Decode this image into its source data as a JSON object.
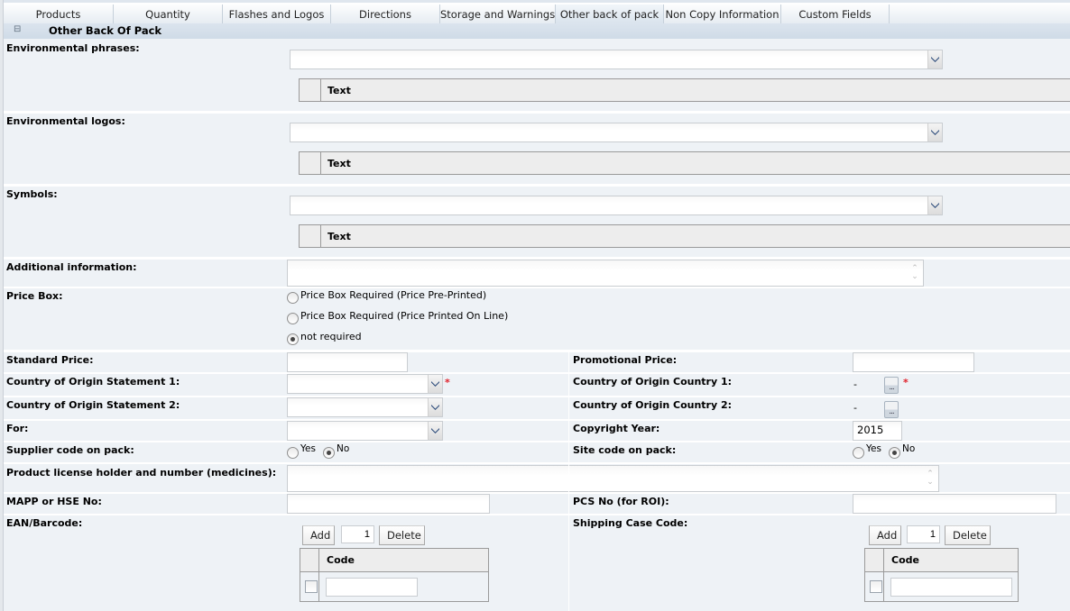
{
  "tabs": [
    {
      "label": "Products",
      "active": false
    },
    {
      "label": "Quantity",
      "active": false
    },
    {
      "label": "Flashes and Logos",
      "active": false
    },
    {
      "label": "Directions",
      "active": false
    },
    {
      "label": "Storage and Warnings",
      "active": false
    },
    {
      "label": "Other back of pack",
      "active": true
    },
    {
      "label": "Non Copy Information",
      "active": false
    },
    {
      "label": "Custom Fields",
      "active": false
    }
  ],
  "section": {
    "collapse_icon": "⊟",
    "title": "Other Back Of Pack"
  },
  "environmental_phrases": {
    "label": "Environmental phrases:",
    "value": "",
    "grid_column": "Text"
  },
  "environmental_logos": {
    "label": "Environmental logos:",
    "value": "",
    "grid_column": "Text"
  },
  "symbols": {
    "label": "Symbols:",
    "value": "",
    "grid_column": "Text"
  },
  "additional_information": {
    "label": "Additional information:",
    "value": ""
  },
  "price_box": {
    "label": "Price Box:",
    "options": [
      {
        "label": "Price Box Required (Price Pre-Printed)",
        "checked": false
      },
      {
        "label": "Price Box Required (Price Printed On Line)",
        "checked": false
      },
      {
        "label": "not required",
        "checked": true
      }
    ]
  },
  "standard_price": {
    "label": "Standard Price:",
    "value": ""
  },
  "promotional_price": {
    "label": "Promotional Price:",
    "value": ""
  },
  "coo_statement_1": {
    "label": "Country of Origin Statement 1:",
    "value": "",
    "required_marker": "*"
  },
  "coo_country_1": {
    "label": "Country of Origin Country 1:",
    "value": "-",
    "lookup_label": "...",
    "required_marker": "*"
  },
  "coo_statement_2": {
    "label": "Country of Origin Statement 2:",
    "value": ""
  },
  "coo_country_2": {
    "label": "Country of Origin Country 2:",
    "value": "-",
    "lookup_label": "..."
  },
  "for": {
    "label": "For:",
    "value": ""
  },
  "copyright_year": {
    "label": "Copyright Year:",
    "value": "2015"
  },
  "supplier_code": {
    "label": "Supplier code on pack:",
    "yes": "Yes",
    "no": "No",
    "selected": "No"
  },
  "site_code": {
    "label": "Site code on pack:",
    "yes": "Yes",
    "no": "No",
    "selected": "No"
  },
  "product_license": {
    "label": "Product license holder and number (medicines):",
    "value": ""
  },
  "mapp_hse": {
    "label": "MAPP or HSE No:",
    "value": ""
  },
  "pcs_no": {
    "label": "PCS No (for ROI):",
    "value": ""
  },
  "ean_barcode": {
    "label": "EAN/Barcode:",
    "add_label": "Add",
    "count": "1",
    "delete_label": "Delete",
    "column": "Code",
    "rows": [
      {
        "code": ""
      }
    ]
  },
  "shipping_case_code": {
    "label": "Shipping Case Code:",
    "add_label": "Add",
    "count": "1",
    "delete_label": "Delete",
    "column": "Code",
    "rows": [
      {
        "code": ""
      }
    ]
  },
  "icons": {
    "dropdown": "chevron-down-icon",
    "spinner_up": "⌃",
    "spinner_down": "⌄"
  }
}
